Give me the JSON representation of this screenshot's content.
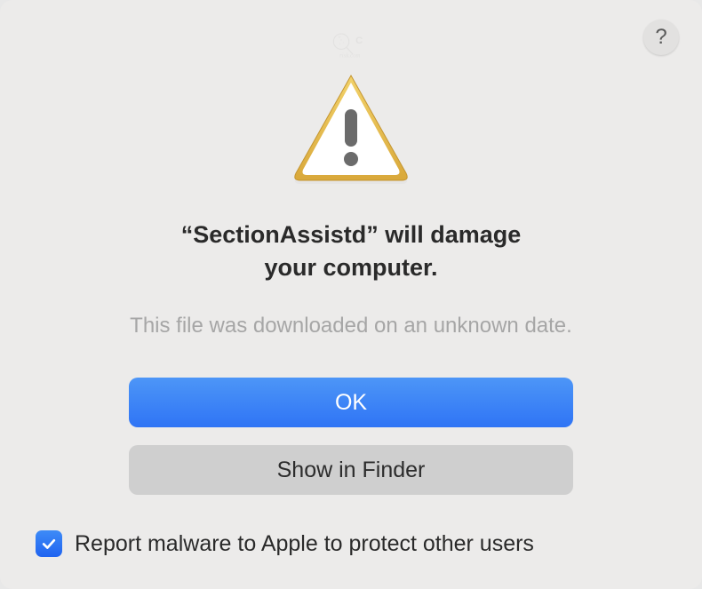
{
  "dialog": {
    "help_label": "?",
    "title_line1": "“SectionAssistd” will damage",
    "title_line2": "your computer.",
    "subtitle": "This file was downloaded on an unknown date.",
    "primary_button": "OK",
    "secondary_button": "Show in Finder",
    "checkbox_label": "Report malware to Apple to protect other users",
    "checkbox_checked": true
  },
  "icons": {
    "warning": "warning-icon",
    "help": "help-icon",
    "checkmark": "checkmark-icon"
  }
}
